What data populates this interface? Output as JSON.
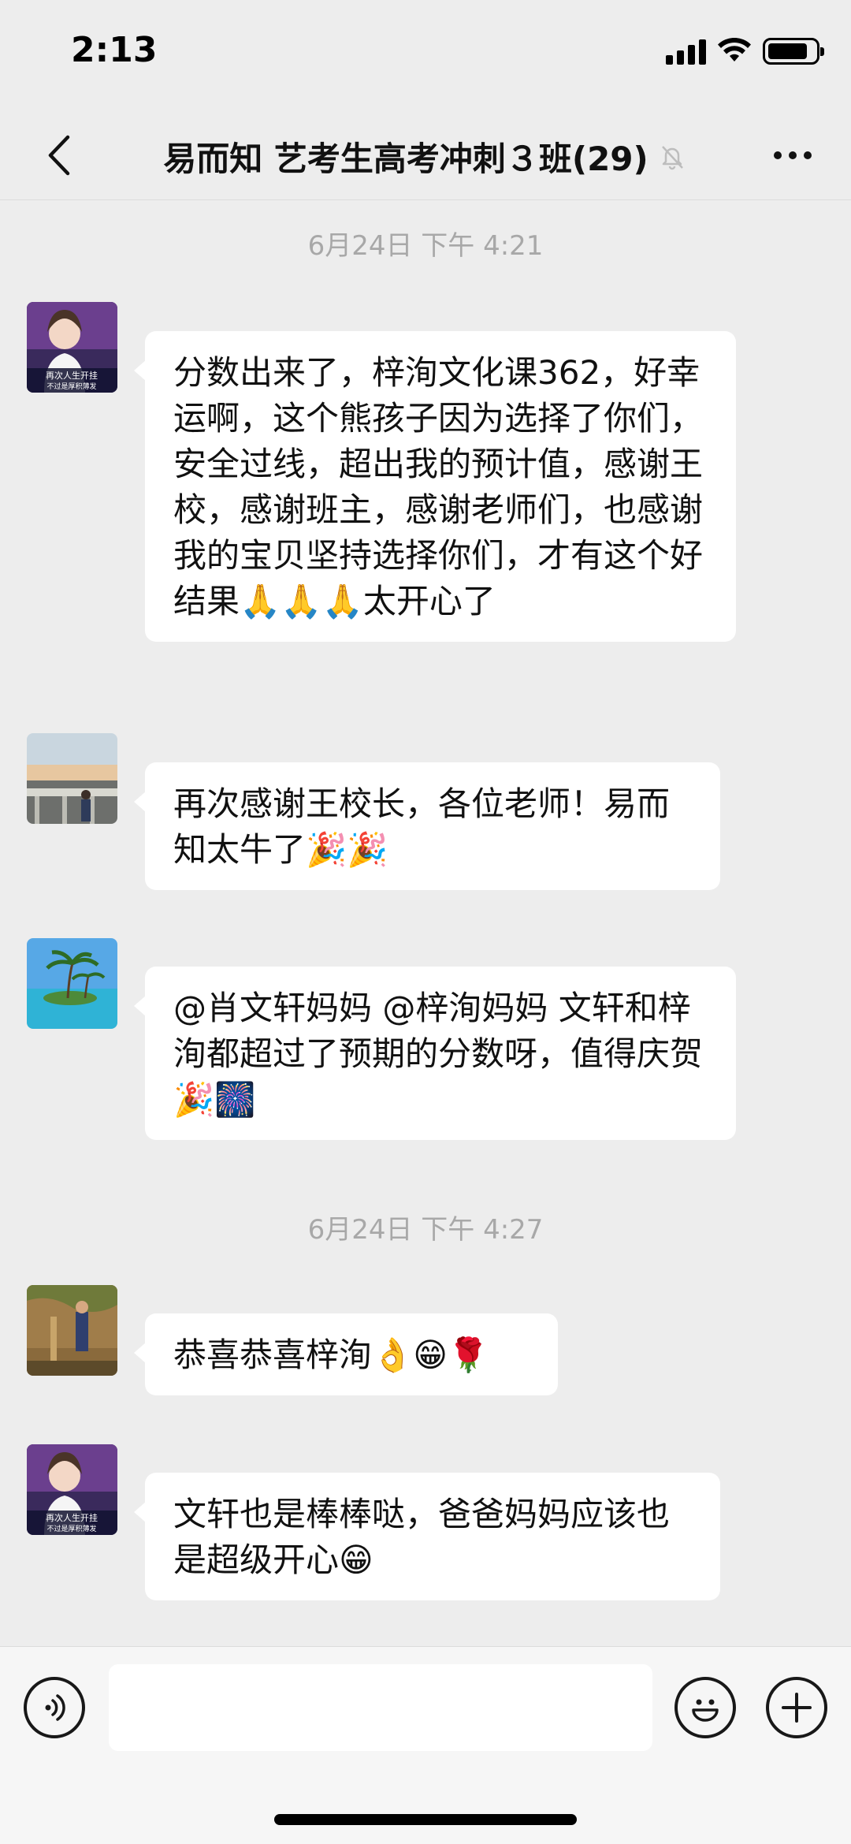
{
  "status_bar": {
    "time": "2:13"
  },
  "header": {
    "title": "易而知 艺考生高考冲刺３班(29)"
  },
  "messages": [
    {
      "timestamp": "6月24日 下午 4:21"
    },
    {
      "text": "分数出来了，梓洵文化课362，好幸运啊，这个熊孩子因为选择了你们，安全过线，超出我的预计值，感谢王校，感谢班主，感谢老师们，也感谢我的宝贝坚持选择你们，才有这个好结果🙏🙏🙏太开心了"
    },
    {
      "text": "再次感谢王校长，各位老师！易而知太牛了🎉🎉"
    },
    {
      "text": "@肖文轩妈妈 @梓洵妈妈 文轩和梓洵都超过了预期的分数呀，值得庆贺🎉🎆"
    },
    {
      "timestamp": "6月24日 下午 4:27"
    },
    {
      "text": "恭喜恭喜梓洵👌😁🌹"
    },
    {
      "text": "文轩也是棒棒哒，爸爸妈妈应该也是超级开心😁"
    }
  ],
  "avatars": {
    "a1_caption": "再次人生开挂",
    "a1_sub": "不过是厚积薄发"
  },
  "icons": [
    "back-icon",
    "mute-icon",
    "more-icon",
    "voice-icon",
    "emoji-icon",
    "plus-icon"
  ]
}
